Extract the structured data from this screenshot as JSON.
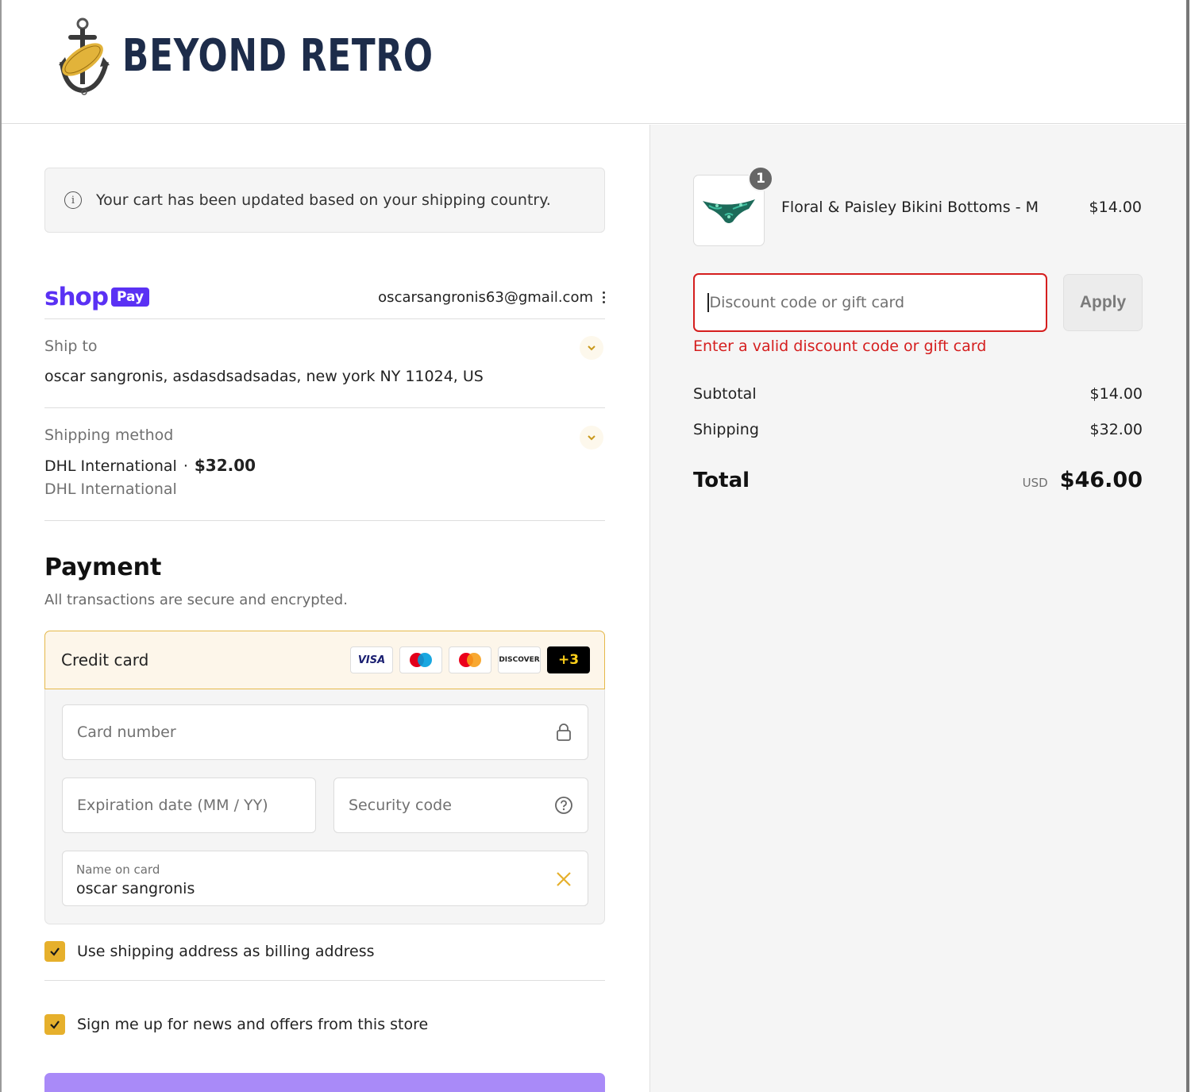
{
  "brand": {
    "name": "BEYOND RETRO"
  },
  "notice": {
    "text": "Your cart has been updated based on your shipping country."
  },
  "shop_pay": {
    "word": "shop",
    "badge": "Pay",
    "email": "oscarsangronis63@gmail.com"
  },
  "ship_to": {
    "label": "Ship to",
    "value": "oscar sangronis, asdasdsadsadas, new york NY 11024, US"
  },
  "shipping_method": {
    "label": "Shipping method",
    "name": "DHL International",
    "separator": "·",
    "price": "$32.00",
    "sub": "DHL International"
  },
  "payment": {
    "title": "Payment",
    "subtitle": "All transactions are secure and encrypted.",
    "method_label": "Credit card",
    "card_brands": [
      "VISA",
      "maestro-icon",
      "mastercard-icon",
      "DISCOVER",
      "+3"
    ],
    "card_number_placeholder": "Card number",
    "expiry_placeholder": "Expiration date (MM / YY)",
    "security_placeholder": "Security code",
    "name_label": "Name on card",
    "name_value": "oscar sangronis"
  },
  "checkboxes": {
    "billing": {
      "label": "Use shipping address as billing address",
      "checked": true
    },
    "newsletter": {
      "label": "Sign me up for news and offers from this store",
      "checked": true
    }
  },
  "cart": {
    "item": {
      "quantity": "1",
      "name": "Floral & Paisley Bikini Bottoms - M",
      "price": "$14.00"
    },
    "discount": {
      "placeholder": "Discount code or gift card",
      "apply_label": "Apply",
      "error": "Enter a valid discount code or gift card"
    },
    "subtotal": {
      "label": "Subtotal",
      "value": "$14.00"
    },
    "shipping": {
      "label": "Shipping",
      "value": "$32.00"
    },
    "total": {
      "label": "Total",
      "currency": "USD",
      "value": "$46.00"
    }
  },
  "colors": {
    "accent": "#e6b02c",
    "shop_pay": "#5a31f4",
    "error": "#d51e1e",
    "pay_button": "#a98af8",
    "brand_navy": "#1d2c4a"
  }
}
